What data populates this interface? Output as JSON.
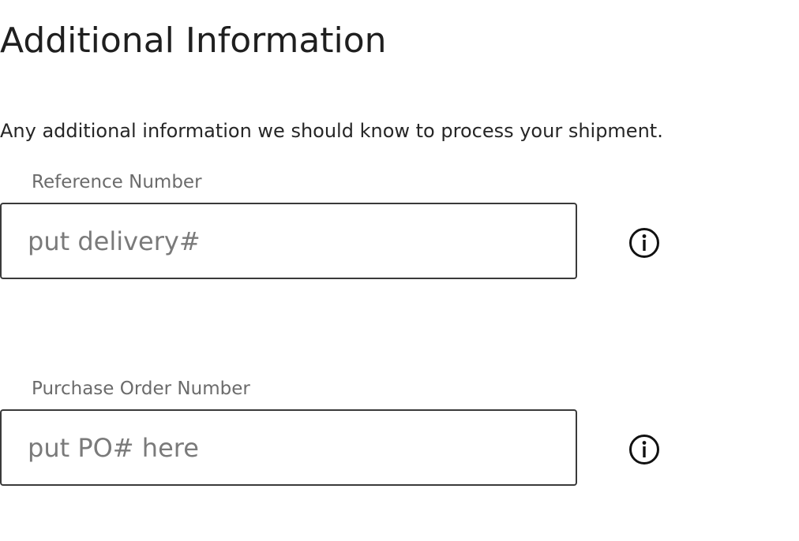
{
  "section": {
    "title": "Additional Information",
    "description": "Any additional information we should know to process your shipment."
  },
  "fields": [
    {
      "label": "Reference Number",
      "value": "",
      "placeholder": "put delivery#",
      "info_icon": "info-icon"
    },
    {
      "label": "Purchase Order Number",
      "value": "",
      "placeholder": "put PO# here",
      "info_icon": "info-icon"
    }
  ]
}
